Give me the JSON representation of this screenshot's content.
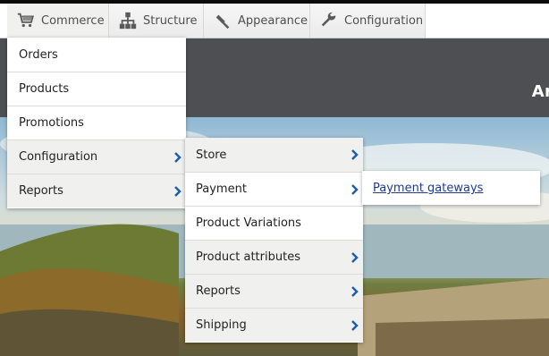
{
  "toolbar": {
    "tabs": [
      {
        "label": "Commerce",
        "icon": "cart-icon"
      },
      {
        "label": "Structure",
        "icon": "sitemap-icon"
      },
      {
        "label": "Appearance",
        "icon": "paintbrush-icon"
      },
      {
        "label": "Configuration",
        "icon": "wrench-icon"
      }
    ]
  },
  "header": {
    "title": "Artw"
  },
  "commerce_menu": {
    "items": [
      {
        "label": "Orders"
      },
      {
        "label": "Products"
      },
      {
        "label": "Promotions"
      },
      {
        "label": "Configuration"
      },
      {
        "label": "Reports"
      }
    ]
  },
  "configuration_menu": {
    "items": [
      {
        "label": "Store"
      },
      {
        "label": "Payment"
      },
      {
        "label": "Product Variations"
      },
      {
        "label": "Product attributes"
      },
      {
        "label": "Reports"
      },
      {
        "label": "Shipping"
      }
    ]
  },
  "payment_menu": {
    "items": [
      {
        "label": "Payment gateways"
      }
    ]
  },
  "colors": {
    "accent": "#1f5ea8",
    "header_bg": "#4e4f52",
    "toolbar_bg": "#ffffff"
  }
}
